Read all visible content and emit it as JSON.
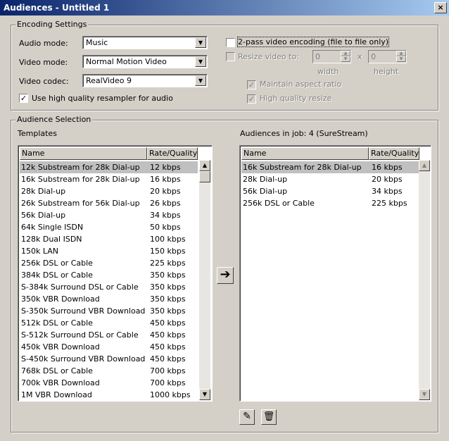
{
  "window": {
    "title": "Audiences - Untitled 1",
    "close_glyph": "×"
  },
  "encoding": {
    "legend": "Encoding Settings",
    "audio_mode_label": "Audio mode:",
    "audio_mode_value": "Music",
    "video_mode_label": "Video mode:",
    "video_mode_value": "Normal Motion Video",
    "video_codec_label": "Video codec:",
    "video_codec_value": "RealVideo 9",
    "hq_resampler_label": "Use high quality resampler for audio",
    "hq_resampler_checked": true,
    "twopass_label": "2-pass video encoding (file to file only)",
    "twopass_checked": false,
    "resize_label": "Resize video to:",
    "resize_checked": false,
    "width_value": "0",
    "height_value": "0",
    "times_sign": "x",
    "width_label": "width",
    "height_label": "height",
    "aspect_label": "Maintain aspect ratio",
    "aspect_checked": true,
    "hq_resize_label": "High quality resize",
    "hq_resize_checked": true
  },
  "audience": {
    "legend": "Audience Selection",
    "templates_label": "Templates",
    "job_label": "Audiences in job: 4  (SureStream)",
    "col_name": "Name",
    "col_rate": "Rate/Quality",
    "templates": [
      {
        "name": "12k Substream for 28k Dial-up",
        "rate": "12 kbps",
        "selected": true
      },
      {
        "name": "16k Substream for 28k Dial-up",
        "rate": "16 kbps"
      },
      {
        "name": "28k Dial-up",
        "rate": "20 kbps"
      },
      {
        "name": "26k Substream for 56k Dial-up",
        "rate": "26 kbps"
      },
      {
        "name": "56k Dial-up",
        "rate": "34 kbps"
      },
      {
        "name": "64k Single ISDN",
        "rate": "50 kbps"
      },
      {
        "name": "128k Dual ISDN",
        "rate": "100 kbps"
      },
      {
        "name": "150k LAN",
        "rate": "150 kbps"
      },
      {
        "name": "256k DSL or Cable",
        "rate": "225 kbps"
      },
      {
        "name": "384k DSL or Cable",
        "rate": "350 kbps"
      },
      {
        "name": "S-384k Surround DSL or Cable",
        "rate": "350 kbps"
      },
      {
        "name": "350k VBR Download",
        "rate": "350 kbps"
      },
      {
        "name": "S-350k Surround VBR Download",
        "rate": "350 kbps"
      },
      {
        "name": "512k DSL or Cable",
        "rate": "450 kbps"
      },
      {
        "name": "S-512k Surround DSL or Cable",
        "rate": "450 kbps"
      },
      {
        "name": "450k VBR Download",
        "rate": "450 kbps"
      },
      {
        "name": "S-450k Surround VBR Download",
        "rate": "450 kbps"
      },
      {
        "name": "768k DSL or Cable",
        "rate": "700 kbps"
      },
      {
        "name": "700k VBR Download",
        "rate": "700 kbps"
      },
      {
        "name": "1M VBR Download",
        "rate": "1000 kbps"
      }
    ],
    "job": [
      {
        "name": "16k Substream for 28k Dial-up",
        "rate": "16 kbps",
        "selected": true
      },
      {
        "name": "28k Dial-up",
        "rate": "20 kbps"
      },
      {
        "name": "56k Dial-up",
        "rate": "34 kbps"
      },
      {
        "name": "256k DSL or Cable",
        "rate": "225 kbps"
      }
    ],
    "add_arrow": "➔",
    "edit_icon": "✎",
    "delete_icon": "🗑"
  }
}
